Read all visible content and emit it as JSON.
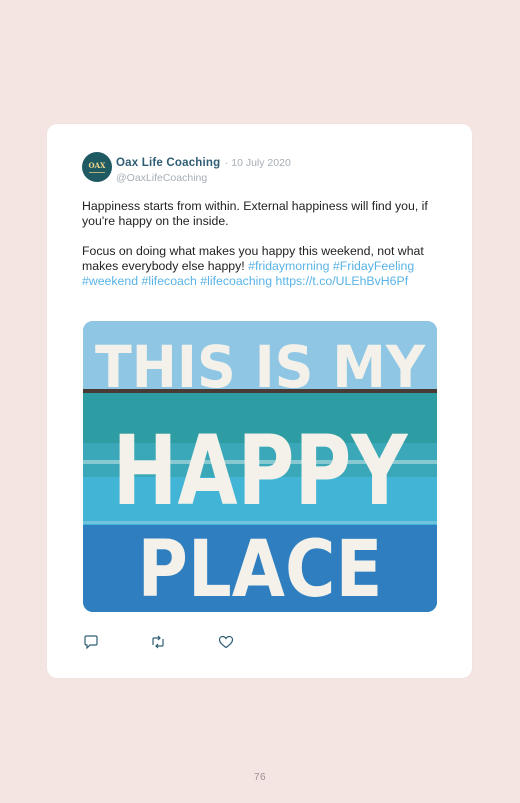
{
  "tweet": {
    "account_name": "Oax Life Coaching",
    "date": "· 10 July 2020",
    "handle": "@OaxLifeCoaching",
    "avatar_text": "OAX",
    "paragraph1": "Happiness starts from within.  External happiness will find you, if you're happy on the inside.",
    "paragraph2_text": "Focus on doing what makes you happy this weekend, not what makes everybody else happy!",
    "hashtags": [
      "#fridaymorning",
      "#FridayFeeling",
      "#weekend",
      "#lifecoach",
      "#lifecoaching"
    ],
    "link": "https://t.co/ULEhBvH6Pf",
    "image_text": {
      "line1": "THIS IS MY",
      "line2": "HAPPY",
      "line3": "PLACE"
    }
  },
  "icons": {
    "reply": "reply-icon",
    "retweet": "retweet-icon",
    "like": "heart-icon"
  },
  "colors": {
    "page_background": "#f4e4e2",
    "name": "#2f5d73",
    "link": "#59b3e6",
    "meta": "#a5aeb6"
  },
  "page_number": "76"
}
